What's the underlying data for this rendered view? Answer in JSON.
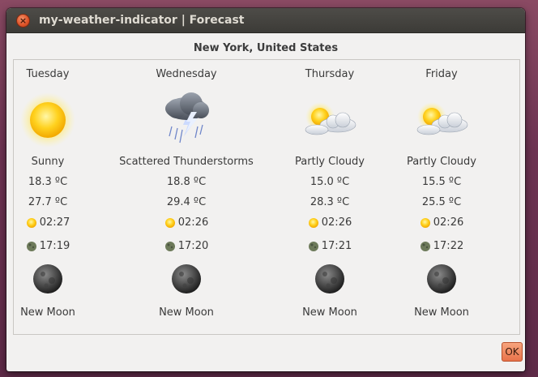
{
  "window": {
    "title": "my-weather-indicator | Forecast",
    "ok_label": "OK"
  },
  "location": "New York, United States",
  "days": [
    {
      "day": "Tuesday",
      "icon": "sunny-icon",
      "condition": "Sunny",
      "temp_min": "18.3 ºC",
      "temp_max": "27.7 ºC",
      "sunrise": "02:27",
      "sunset": "17:19",
      "moon_phase": "New Moon"
    },
    {
      "day": "Wednesday",
      "icon": "thunderstorm-icon",
      "condition": "Scattered Thunderstorms",
      "temp_min": "18.8 ºC",
      "temp_max": "29.4 ºC",
      "sunrise": "02:26",
      "sunset": "17:20",
      "moon_phase": "New Moon"
    },
    {
      "day": "Thursday",
      "icon": "partly-cloudy-icon",
      "condition": "Partly Cloudy",
      "temp_min": "15.0 ºC",
      "temp_max": "28.3 ºC",
      "sunrise": "02:26",
      "sunset": "17:21",
      "moon_phase": "New Moon"
    },
    {
      "day": "Friday",
      "icon": "partly-cloudy-icon",
      "condition": "Partly Cloudy",
      "temp_min": "15.5 ºC",
      "temp_max": "25.5 ºC",
      "sunrise": "02:26",
      "sunset": "17:22",
      "moon_phase": "New Moon"
    }
  ],
  "colors": {
    "titlebar": "#3c3b37",
    "window_bg": "#f2f1f0",
    "accent": "#e8724a"
  }
}
